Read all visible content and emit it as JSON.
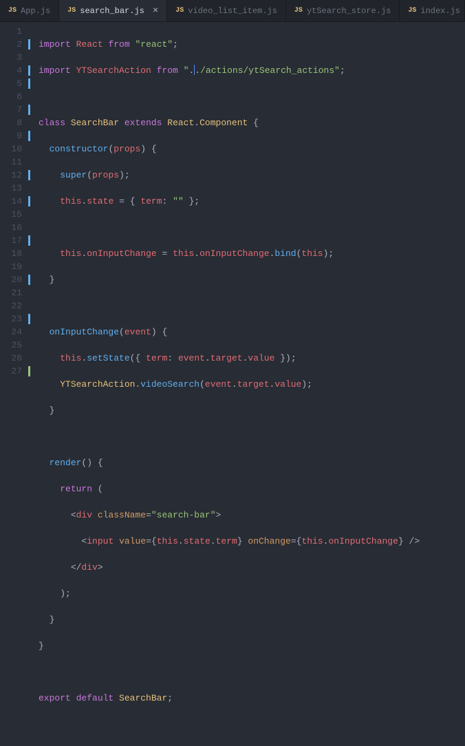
{
  "tabs": [
    {
      "lang": "JS",
      "label": "App.js",
      "active": false
    },
    {
      "lang": "JS",
      "label": "search_bar.js",
      "active": true
    },
    {
      "lang": "JS",
      "label": "video_list_item.js",
      "active": false
    },
    {
      "lang": "JS",
      "label": "ytSearch_store.js",
      "active": false
    },
    {
      "lang": "JS",
      "label": "index.js",
      "active": false
    }
  ],
  "code": {
    "l1": {
      "import": "import",
      "react": "React",
      "from": "from",
      "str": "\"react\""
    },
    "l2": {
      "import": "import",
      "ident": "YTSearchAction",
      "from": "from",
      "str_a": "\".",
      "str_b": "./actions/ytSearch_actions\""
    },
    "l4": {
      "class": "class",
      "name": "SearchBar",
      "extends": "extends",
      "react": "React",
      "comp": "Component"
    },
    "l5": {
      "ctor": "constructor",
      "param": "props"
    },
    "l6": {
      "super": "super",
      "param": "props"
    },
    "l7": {
      "this": "this",
      "state": "state",
      "term": "term",
      "empty": "\"\""
    },
    "l9": {
      "this": "this",
      "onInputChange": "onInputChange",
      "bind": "bind"
    },
    "l12": {
      "onInputChange": "onInputChange",
      "param": "event"
    },
    "l13": {
      "this": "this",
      "setState": "setState",
      "term": "term",
      "event": "event",
      "target": "target",
      "value": "value"
    },
    "l14": {
      "cls": "YTSearchAction",
      "videoSearch": "videoSearch",
      "event": "event",
      "target": "target",
      "value": "value"
    },
    "l17": {
      "render": "render"
    },
    "l18": {
      "return": "return"
    },
    "l19": {
      "div": "div",
      "className": "className",
      "str": "\"search-bar\""
    },
    "l20": {
      "input": "input",
      "valueAttr": "value",
      "this": "this",
      "state": "state",
      "term": "term",
      "onChangeAttr": "onChange",
      "onInputChange": "onInputChange"
    },
    "l21": {
      "div": "div"
    },
    "l26": {
      "export": "export",
      "default": "default",
      "name": "SearchBar"
    }
  },
  "lineNumbers": [
    "1",
    "2",
    "3",
    "4",
    "5",
    "6",
    "7",
    "8",
    "9",
    "10",
    "11",
    "12",
    "13",
    "14",
    "15",
    "16",
    "17",
    "18",
    "19",
    "20",
    "21",
    "22",
    "23",
    "24",
    "25",
    "26",
    "27"
  ]
}
